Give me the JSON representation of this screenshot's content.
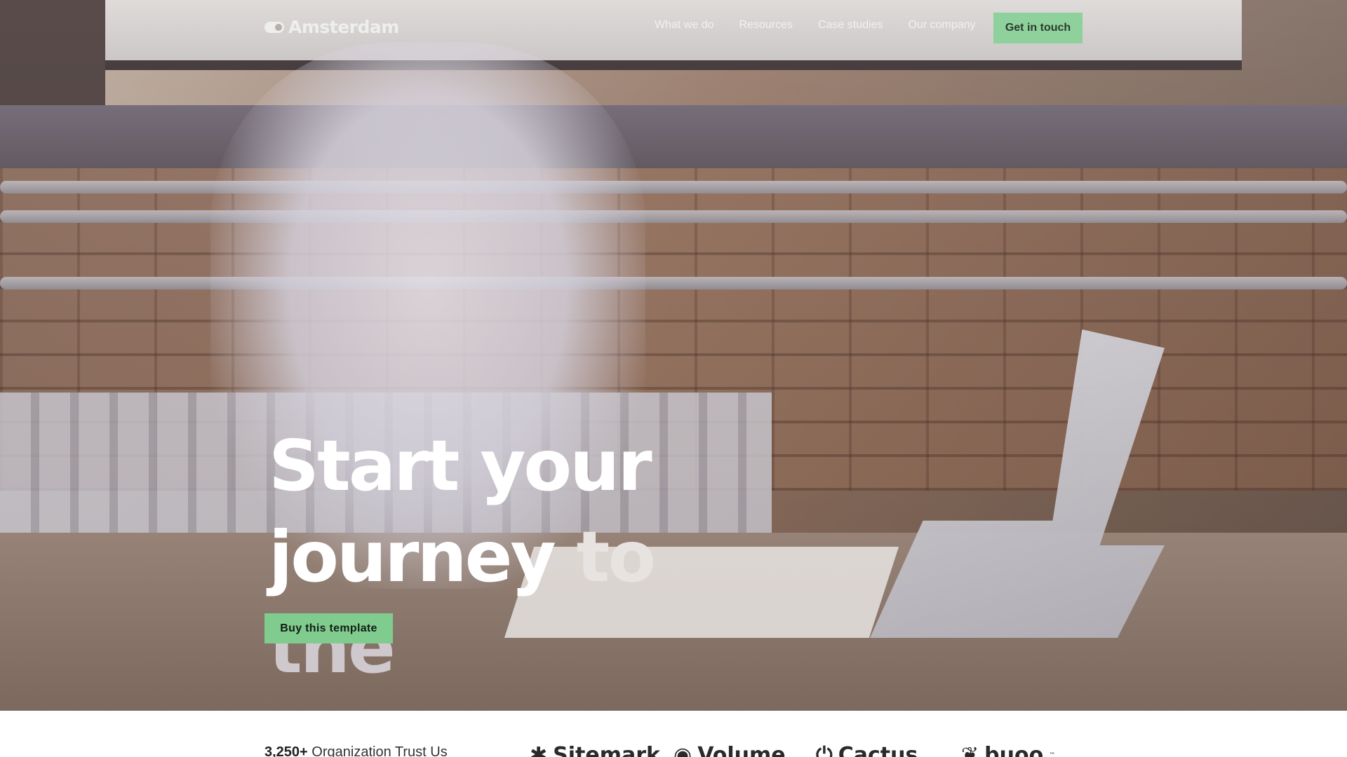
{
  "nav": {
    "logo": {
      "icon": "toggle-logo-icon",
      "text": "Amsterdam"
    },
    "links": [
      "What we do",
      "Resources",
      "Case studies",
      "Our company"
    ],
    "cta": "Get in touch"
  },
  "hero": {
    "headline": {
      "part1": "Start your journey",
      "part2": "to",
      "part3": "the"
    },
    "cta": "Buy this template"
  },
  "trust": {
    "count": "3,250+",
    "text": "Organization Trust Us",
    "brands": [
      {
        "name": "Sitemark",
        "icon": "asterisk-logo-icon"
      },
      {
        "name": "Volume",
        "icon": "circle-logo-icon"
      },
      {
        "name": "Cactus",
        "icon": "power-logo-icon"
      },
      {
        "name": "buoo",
        "icon": "leaf-logo-icon",
        "tm": "™"
      }
    ]
  },
  "colors": {
    "accent": "#80cc8e",
    "accent_light": "#8ed19c",
    "text_dark": "#141c16"
  }
}
